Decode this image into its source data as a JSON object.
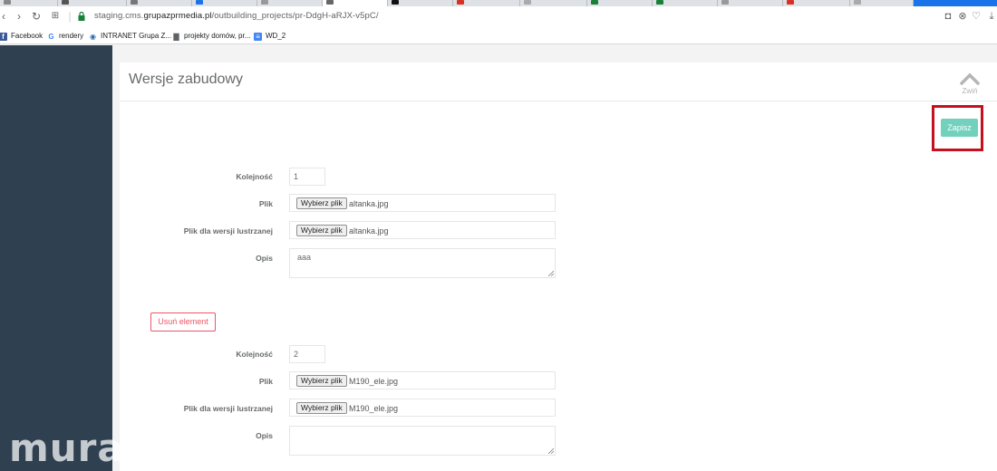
{
  "browser": {
    "url_prefix": "staging.cms.",
    "url_host": "grupazprmedia.pl",
    "url_path": "/outbuilding_projects/pr-DdgH-aRJX-v5pC/",
    "bookmarks": [
      {
        "label": "Facebook",
        "icon": "facebook-icon",
        "color": "#3b5998",
        "glyph": "f"
      },
      {
        "label": "rendery",
        "icon": "google-icon",
        "color": "#4285f4",
        "glyph": "G"
      },
      {
        "label": "INTRANET Grupa Z...",
        "icon": "intranet-icon",
        "color": "#2b6cb0",
        "glyph": "◉"
      },
      {
        "label": "projekty domów, pr...",
        "icon": "document-icon",
        "color": "#5f6368",
        "glyph": "▇"
      },
      {
        "label": "WD_2",
        "icon": "docs-icon",
        "color": "#4285f4",
        "glyph": "≡"
      }
    ]
  },
  "panel": {
    "title": "Wersje zabudowy",
    "collapse_label": "Zwiń",
    "save_label": "Zapisz"
  },
  "form": {
    "labels": {
      "order": "Kolejność",
      "file": "Plik",
      "mirror_file": "Plik dla wersji lustrzanej",
      "description": "Opis"
    },
    "choose_file_label": "Wybierz plik",
    "remove_label": "Usuń element",
    "items": [
      {
        "order": "1",
        "file": "altanka.jpg",
        "mirror_file": "altanka.jpg",
        "description": "aaa"
      },
      {
        "order": "2",
        "file": "M190_ele.jpg",
        "mirror_file": "M190_ele.jpg",
        "description": ""
      }
    ]
  },
  "watermark": "mura",
  "colors": {
    "sidebar": "#2f4050",
    "save_button": "#72d1bd",
    "remove_button": "#ed5565",
    "highlight": "#c4111f"
  }
}
